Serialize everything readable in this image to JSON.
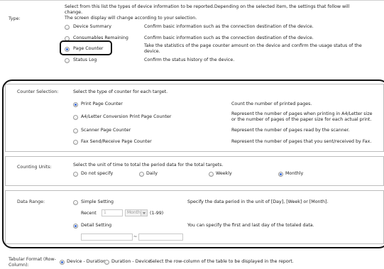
{
  "type": {
    "label": "Type:",
    "intro_line1": "Select from this list the types of device information to be reported.Depending on the selected item, the settings that follow will",
    "intro_line2": "change.",
    "intro_line3": "The screen display will change according to your selection.",
    "options": [
      {
        "label": "Device Summary",
        "desc": "Confirm basic information such as the connection destination of the device.",
        "selected": false
      },
      {
        "label": "Consumables Remaining",
        "desc": "Confirm basic information such as the connection destination of the device.",
        "selected": false
      },
      {
        "label": "Page Counter",
        "desc1": "Take the statistics of the page counter amount on the device and confirm the usage status of the",
        "desc2": "device.",
        "selected": true
      },
      {
        "label": "Status Log",
        "desc": "Confirm the status history of the device.",
        "selected": false
      }
    ]
  },
  "counter": {
    "label": "Counter Selection:",
    "intro": "Select the type of counter for each target.",
    "options": [
      {
        "label": "Print Page Counter",
        "desc": "Count the number of printed pages.",
        "selected": true
      },
      {
        "label": "A4/Letter Conversion Print Page Counter",
        "desc1": "Represent the number of pages when printing in A4/Letter size",
        "desc2": "or the number of pages of the paper size for each actual print.",
        "selected": false
      },
      {
        "label": "Scanner Page Counter",
        "desc": "Represent the number of pages read by the scanner.",
        "selected": false
      },
      {
        "label": "Fax Send/Receive Page Counter",
        "desc": "Represent the number of pages that you sent/received by Fax.",
        "selected": false
      }
    ]
  },
  "units": {
    "label": "Counting Units:",
    "intro": "Select the unit of time to total the period data for the total targets.",
    "options": [
      {
        "label": "Do not specify",
        "selected": false
      },
      {
        "label": "Daily",
        "selected": false
      },
      {
        "label": "Weekly",
        "selected": false
      },
      {
        "label": "Monthly",
        "selected": true
      }
    ]
  },
  "range": {
    "label": "Data Range:",
    "simple_label": "Simple Setting",
    "simple_desc": "Specify the data period in the unit of [Day], [Week] or [Month].",
    "recent_label": "Recent",
    "recent_value": "1",
    "unit_value": "Month",
    "range_hint": "(1-99)",
    "detail_label": "Detail Setting",
    "detail_desc": "You can specify the first and last day of the totaled data.",
    "tilde": "~"
  },
  "tabular": {
    "label_line1": "Tabular Format (Row-",
    "label_line2": "Column):",
    "opt1": "Device - Duration",
    "opt2": "Duration - Device",
    "desc": "Select the row-column of the table to be displayed in the report."
  }
}
